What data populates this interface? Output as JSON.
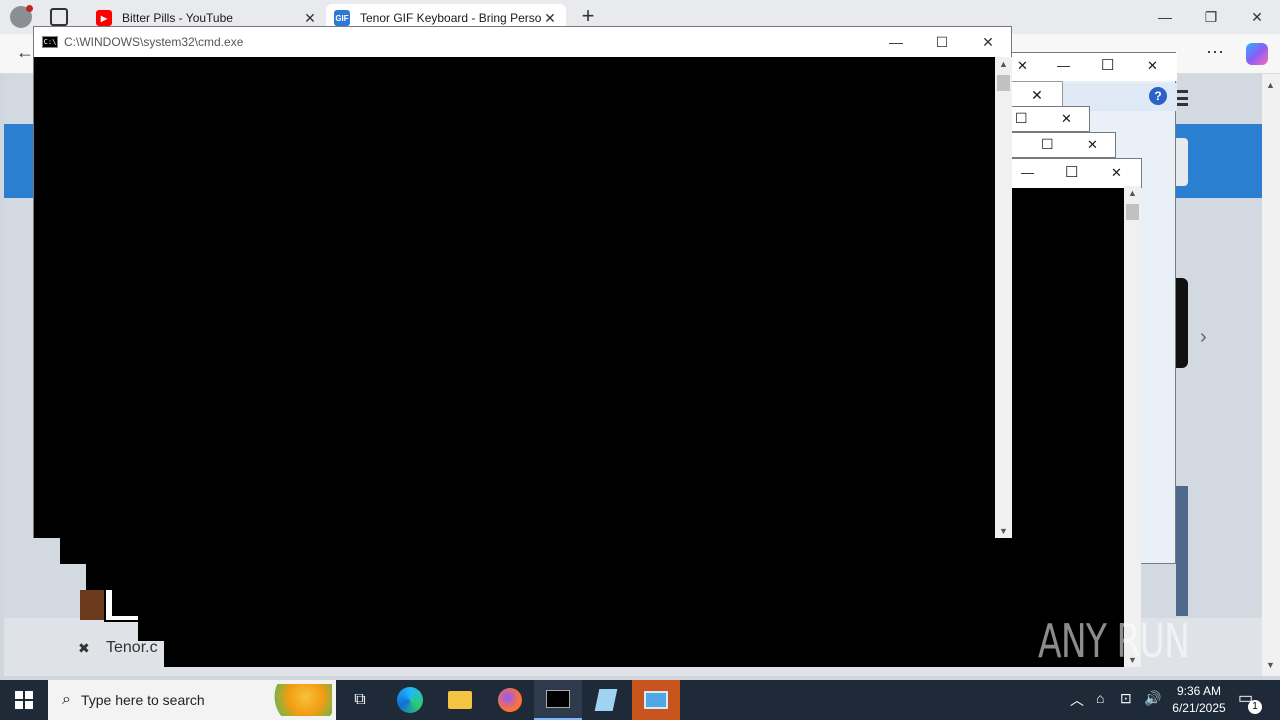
{
  "browser": {
    "tabs": [
      {
        "title": "Bitter Pills - YouTube",
        "icon": "youtube-icon"
      },
      {
        "title": "Tenor GIF Keyboard - Bring Perso",
        "icon": "tenor-gif-icon"
      }
    ],
    "new_tab": "+",
    "favicon_gif_text": "GIF"
  },
  "cmd": {
    "title": "C:\\WINDOWS\\system32\\cmd.exe"
  },
  "page": {
    "footer_close": "✖",
    "footer_text": "Tenor.c"
  },
  "taskbar": {
    "search_placeholder": "Type here to search",
    "time": "9:36 AM",
    "date": "6/21/2025",
    "notification_count": "1"
  },
  "watermark": "ANY RUN",
  "colors": {
    "taskbar": "#1f2a38",
    "accent_blue": "#2b7fd1",
    "active_task": "#c8551e"
  }
}
